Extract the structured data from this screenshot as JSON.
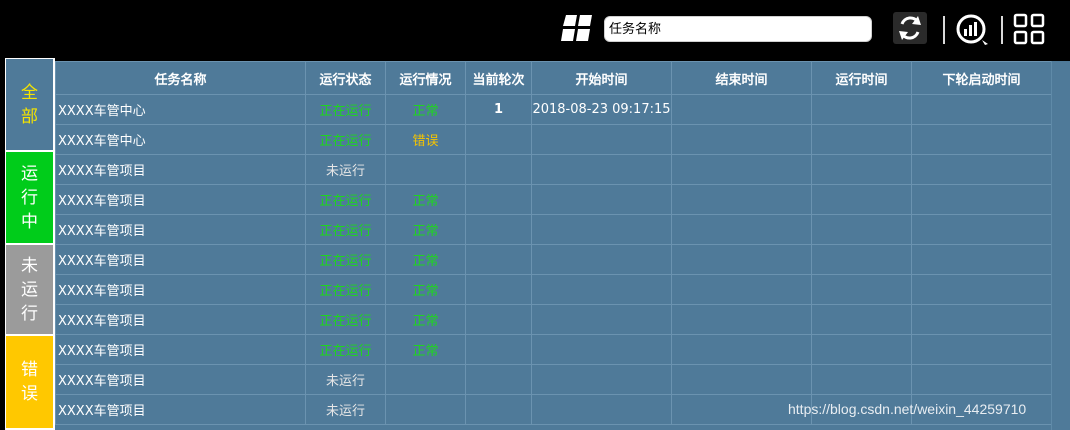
{
  "toolbar": {
    "search_placeholder": "任务名称",
    "icons": [
      "windows-grid-icon",
      "refresh-icon",
      "chart-report-icon",
      "apps-grid-icon"
    ]
  },
  "filter_tabs": [
    {
      "label": "全部",
      "bg": "#4f7a99",
      "color": "#f5e400"
    },
    {
      "label": "运行中",
      "bg": "#00cc1a",
      "color": "#ffffff"
    },
    {
      "label": "未运行",
      "bg": "#9b9b9b",
      "color": "#ffffff"
    },
    {
      "label": "错误",
      "bg": "#ffc800",
      "color": "#ffffff"
    }
  ],
  "table": {
    "columns": [
      "任务名称",
      "运行状态",
      "运行情况",
      "当前轮次",
      "开始时间",
      "结束时间",
      "运行时间",
      "下轮启动时间"
    ],
    "rows": [
      {
        "name": "XXXX车管中心",
        "status": "正在运行",
        "condition": "正常",
        "round": "1",
        "start": "2018-08-23 09:17:15",
        "end": "",
        "runtime": "",
        "next": ""
      },
      {
        "name": "XXXX车管中心",
        "status": "正在运行",
        "condition": "错误",
        "round": "",
        "start": "",
        "end": "",
        "runtime": "",
        "next": ""
      },
      {
        "name": "XXXX车管项目",
        "status": "未运行",
        "condition": "",
        "round": "",
        "start": "",
        "end": "",
        "runtime": "",
        "next": ""
      },
      {
        "name": "XXXX车管项目",
        "status": "正在运行",
        "condition": "正常",
        "round": "",
        "start": "",
        "end": "",
        "runtime": "",
        "next": ""
      },
      {
        "name": "XXXX车管项目",
        "status": "正在运行",
        "condition": "正常",
        "round": "",
        "start": "",
        "end": "",
        "runtime": "",
        "next": ""
      },
      {
        "name": "XXXX车管项目",
        "status": "正在运行",
        "condition": "正常",
        "round": "",
        "start": "",
        "end": "",
        "runtime": "",
        "next": ""
      },
      {
        "name": "XXXX车管项目",
        "status": "正在运行",
        "condition": "正常",
        "round": "",
        "start": "",
        "end": "",
        "runtime": "",
        "next": ""
      },
      {
        "name": "XXXX车管项目",
        "status": "正在运行",
        "condition": "正常",
        "round": "",
        "start": "",
        "end": "",
        "runtime": "",
        "next": ""
      },
      {
        "name": "XXXX车管项目",
        "status": "正在运行",
        "condition": "正常",
        "round": "",
        "start": "",
        "end": "",
        "runtime": "",
        "next": ""
      },
      {
        "name": "XXXX车管项目",
        "status": "未运行",
        "condition": "",
        "round": "",
        "start": "",
        "end": "",
        "runtime": "",
        "next": ""
      },
      {
        "name": "XXXX车管项目",
        "status": "未运行",
        "condition": "",
        "round": "",
        "start": "",
        "end": "",
        "runtime": "",
        "next": ""
      }
    ]
  },
  "watermark": "https://blog.csdn.net/weixin_44259710",
  "colors": {
    "table_bg": "#4f7a99",
    "running": "#1ed61e",
    "error": "#f5c400"
  }
}
